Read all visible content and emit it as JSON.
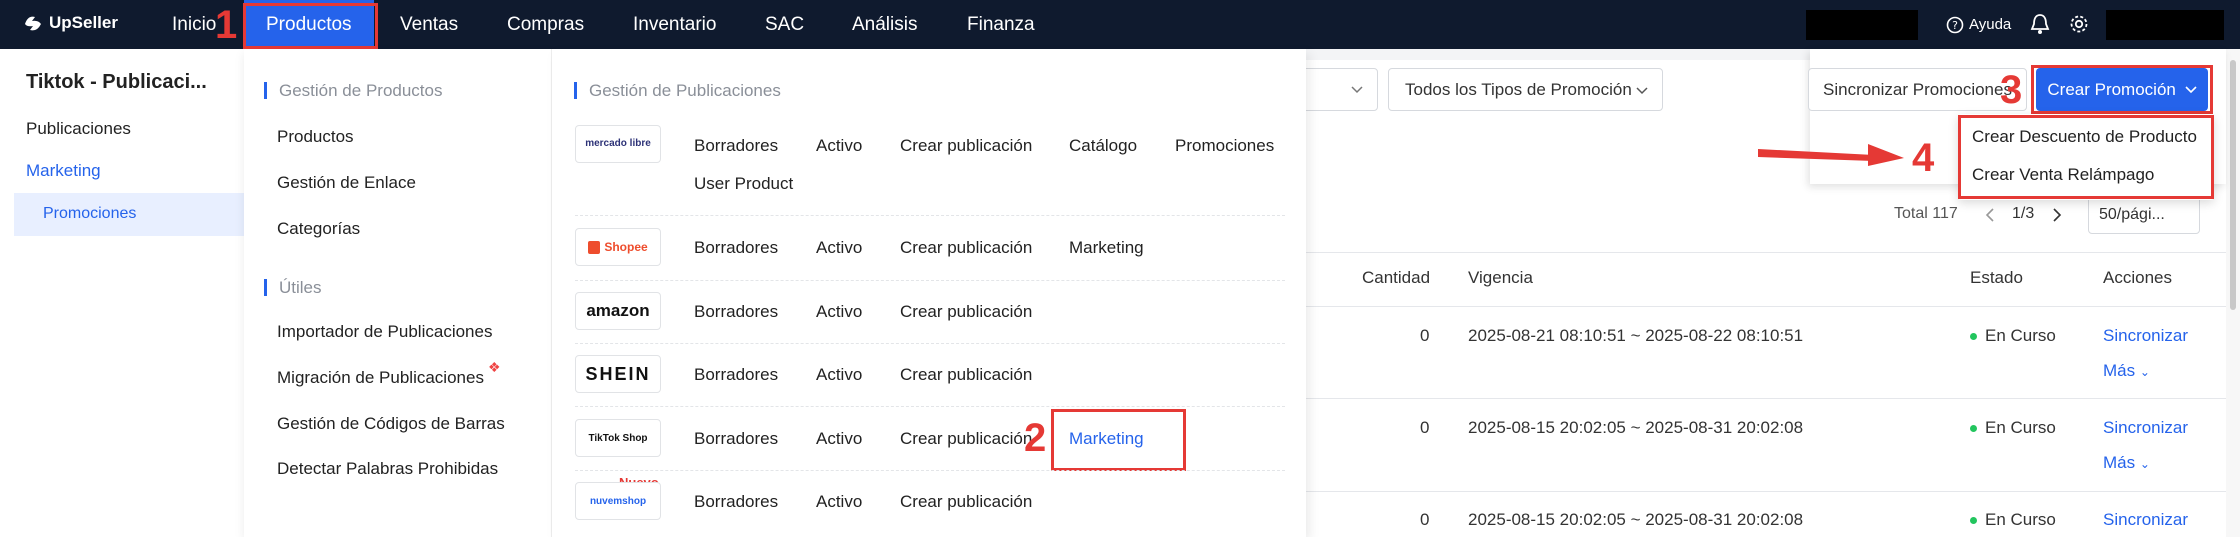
{
  "topnav": {
    "logo_text": "UpSeller",
    "items": [
      "Inicio",
      "Productos",
      "Ventas",
      "Compras",
      "Inventario",
      "SAC",
      "Análisis",
      "Finanza"
    ],
    "help_label": "Ayuda"
  },
  "annotations": [
    "1",
    "2",
    "3",
    "4"
  ],
  "sidebar": {
    "title": "Tiktok - Publicaci...",
    "items": [
      "Publicaciones",
      "Marketing",
      "Promociones"
    ]
  },
  "filters": {
    "promo_type": "Todos los Tipos de Promoción",
    "sync_label": "Sincronizar Promociones",
    "create_label": "Crear Promoción",
    "create_menu": [
      "Crear Descuento de Producto",
      "Crear Venta Relámpago"
    ]
  },
  "pager": {
    "total": "Total 117",
    "page": "1/3",
    "per_page": "50/pági..."
  },
  "table": {
    "headers": [
      "Cantidad",
      "Vigencia",
      "Estado",
      "Acciones"
    ],
    "rows": [
      {
        "cantidad": "0",
        "vigencia": "2025-08-21 08:10:51 ~ 2025-08-22 08:10:51",
        "estado": "En Curso",
        "accion": "Sincronizar",
        "mas": "Más"
      },
      {
        "cantidad": "0",
        "vigencia": "2025-08-15 20:02:05 ~ 2025-08-31 20:02:08",
        "estado": "En Curso",
        "accion": "Sincronizar",
        "mas": "Más"
      },
      {
        "cantidad": "0",
        "vigencia": "2025-08-15 20:02:05 ~ 2025-08-31 20:02:08",
        "estado": "En Curso",
        "accion": "Sincronizar"
      }
    ]
  },
  "products_menu": {
    "section_products": "Gestión de Productos",
    "product_items": [
      "Productos",
      "Gestión de Enlace",
      "Categorías"
    ],
    "section_tools": "Útiles",
    "tool_items": [
      "Importador de Publicaciones",
      "Migración de Publicaciones",
      "Gestión de Códigos de Barras",
      "Detectar Palabras Prohibidas"
    ],
    "section_listings": "Gestión de Publicaciones",
    "platforms": [
      {
        "logo": "mercado libre",
        "links": [
          "Borradores",
          "Activo",
          "Crear publicación",
          "Catálogo",
          "Promociones",
          "User Product"
        ]
      },
      {
        "logo": "Shopee",
        "links": [
          "Borradores",
          "Activo",
          "Crear publicación",
          "Marketing"
        ]
      },
      {
        "logo": "amazon",
        "links": [
          "Borradores",
          "Activo",
          "Crear publicación"
        ]
      },
      {
        "logo": "SHEIN",
        "links": [
          "Borradores",
          "Activo",
          "Crear publicación"
        ]
      },
      {
        "logo": "TikTok Shop",
        "links": [
          "Borradores",
          "Activo",
          "Crear publicación",
          "Marketing"
        ]
      },
      {
        "logo": "nuvemshop",
        "badge": "Nuevo",
        "links": [
          "Borradores",
          "Activo",
          "Crear publicación"
        ]
      }
    ]
  },
  "colors": {
    "nav_bg": "#0f1a2e",
    "accent": "#2563eb",
    "annotation": "#e53935",
    "status": "#22c55e"
  }
}
